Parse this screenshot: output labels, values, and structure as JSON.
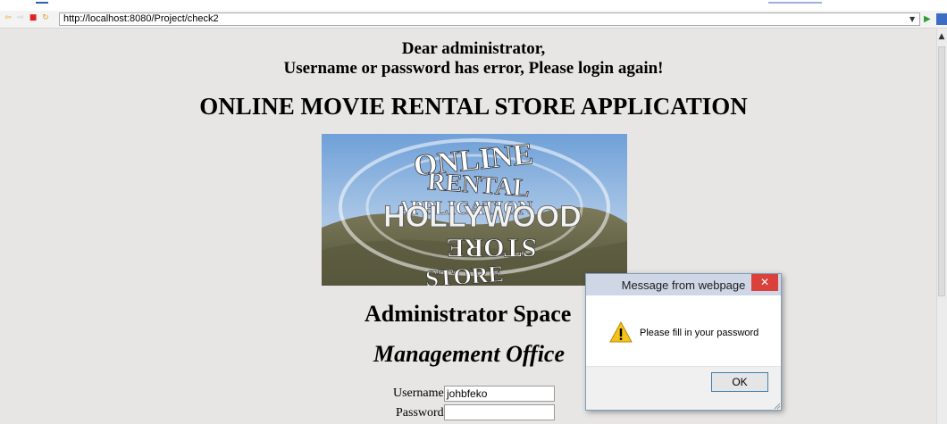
{
  "browser": {
    "url": "http://localhost:8080/Project/check2",
    "icons": [
      "back-arrow-icon",
      "forward-arrow-icon",
      "stop-icon",
      "refresh-icon",
      "dropdown-icon",
      "go-icon"
    ]
  },
  "page": {
    "greeting_line1": "Dear administrator,",
    "greeting_line2": "Username or password has error, Please login again!",
    "app_title": "ONLINE MOVIE RENTAL STORE APPLICATION",
    "banner_words": [
      "ONLINE",
      "RENTAL",
      "APPLICATION",
      "HOLLYWOOD",
      "STORE"
    ],
    "admin_space": "Administrator Space",
    "management_office": "Management Office",
    "form": {
      "username_label": "Username",
      "username_value": "johbfeko",
      "password_label": "Password",
      "password_value": ""
    }
  },
  "dialog": {
    "title": "Message from webpage",
    "message": "Please fill in your password",
    "ok_label": "OK",
    "icon": "warning-icon"
  },
  "colors": {
    "page_bg": "#e7e6e5",
    "dialog_close": "#d9413a",
    "title_bar": "#cfd7e6"
  }
}
